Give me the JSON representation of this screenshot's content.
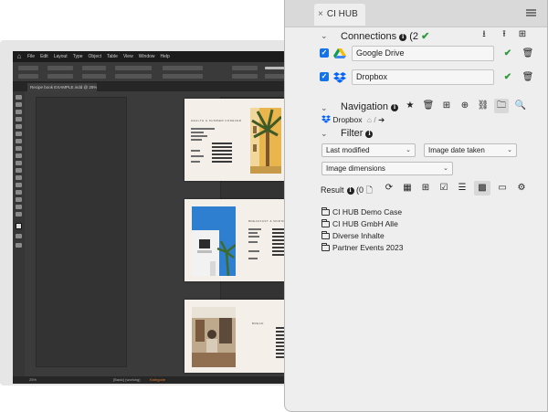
{
  "indesign": {
    "menu": [
      "File",
      "Edit",
      "Layout",
      "Type",
      "Object",
      "Table",
      "View",
      "Window",
      "Help"
    ],
    "doc_tab": "Recipe book EXAMPLE.indd @ 25%",
    "status": {
      "zoom": "25%",
      "page_nav": "[Basic] (working)",
      "errors": "Kategorie"
    },
    "pages": [
      {
        "heading": "HEALTH & SUMMER FOREVER"
      },
      {
        "heading": "BREAKFAST & MORNING FOOD"
      },
      {
        "heading": "BREAD"
      }
    ]
  },
  "panel": {
    "tab_label": "CI HUB",
    "close_icon": "×",
    "connections": {
      "title": "Connections",
      "count": "(2",
      "items": [
        {
          "name": "Google Drive",
          "icon": "google-drive-icon"
        },
        {
          "name": "Dropbox",
          "icon": "dropbox-icon"
        }
      ]
    },
    "navigation": {
      "title": "Navigation",
      "breadcrumb_root": "Dropbox",
      "breadcrumb_sep": "/"
    },
    "filter": {
      "title": "Filter",
      "dropdowns": [
        "Last modified",
        "Image date taken",
        "Image dimensions"
      ]
    },
    "result": {
      "label": "Result",
      "count": "(0",
      "folders": [
        "CI HUB Demo Case",
        "CI HUB GmbH Alle",
        "Diverse Inhalte",
        "Partner Events 2023"
      ]
    }
  },
  "colors": {
    "accent_blue": "#1473e6",
    "success_green": "#2d9a3c",
    "dropbox_blue": "#0061fe"
  }
}
